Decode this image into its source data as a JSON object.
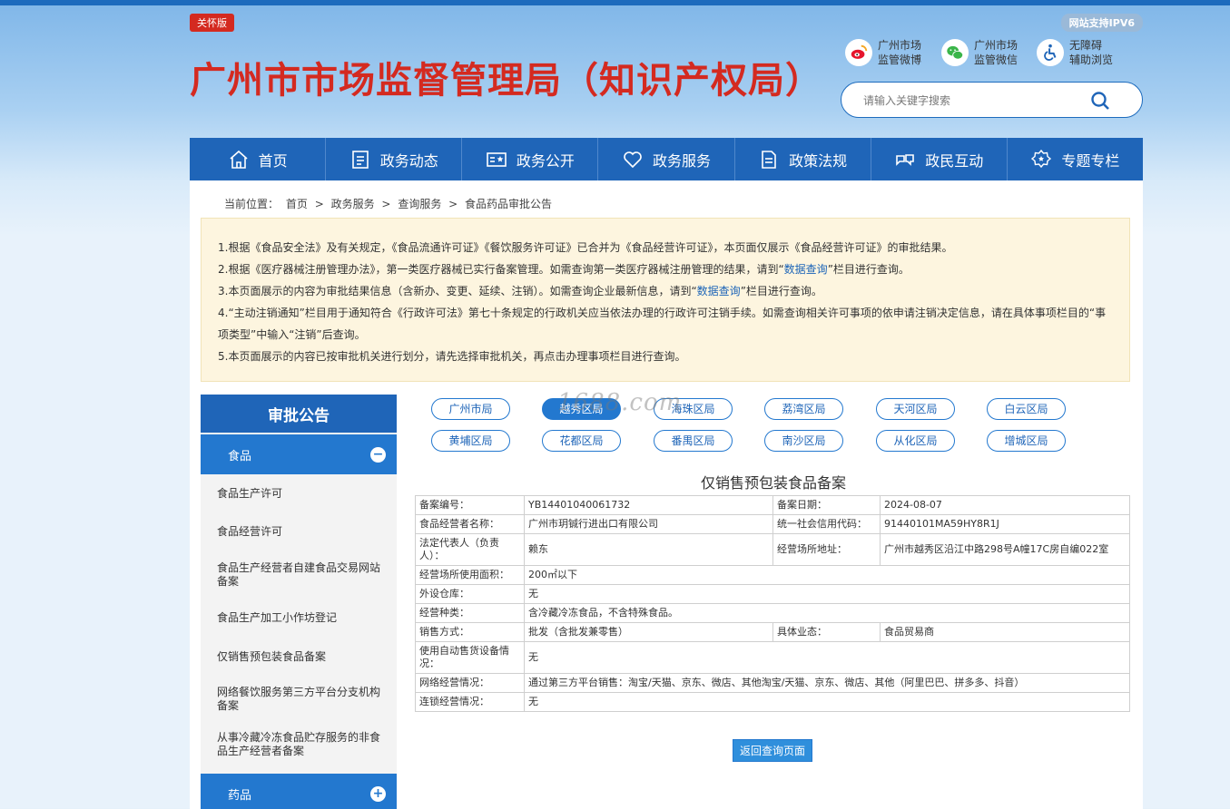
{
  "header": {
    "care_badge": "关怀版",
    "ipv6_badge": "网站支持IPV6",
    "title": "广州市市场监督管理局（知识产权局）",
    "social": [
      {
        "icon": "weibo-icon",
        "line1": "广州市场",
        "line2": "监管微博"
      },
      {
        "icon": "wechat-icon",
        "line1": "广州市场",
        "line2": "监管微信"
      },
      {
        "icon": "accessibility-icon",
        "line1": "无障碍",
        "line2": "辅助浏览"
      }
    ],
    "search_placeholder": "请输入关键字搜索"
  },
  "nav": [
    {
      "label": "首页",
      "icon": "home-icon"
    },
    {
      "label": "政务动态",
      "icon": "news-icon"
    },
    {
      "label": "政务公开",
      "icon": "open-icon"
    },
    {
      "label": "政务服务",
      "icon": "heart-icon"
    },
    {
      "label": "政策法规",
      "icon": "document-icon"
    },
    {
      "label": "政民互动",
      "icon": "interact-icon"
    },
    {
      "label": "专题专栏",
      "icon": "topic-icon"
    }
  ],
  "breadcrumb": {
    "prefix": "当前位置：",
    "items": [
      "首页",
      "政务服务",
      "查询服务",
      "食品药品审批公告"
    ],
    "sep": ">"
  },
  "notice": {
    "l1": "1.根据《食品安全法》及有关规定，《食品流通许可证》《餐饮服务许可证》已合并为《食品经营许可证》，本页面仅展示《食品经营许可证》的审批结果。",
    "l2a": "2.根据《医疗器械注册管理办法》，第一类医疗器械已实行备案管理。如需查询第一类医疗器械注册管理的结果，请到“",
    "l2link": "数据查询",
    "l2b": "”栏目进行查询。",
    "l3a": "3.本页面展示的内容为审批结果信息（含新办、变更、延续、注销）。如需查询企业最新信息，请到“",
    "l3link": "数据查询",
    "l3b": "”栏目进行查询。",
    "l4": "4.“主动注销通知”栏目用于通知符合《行政许可法》第七十条规定的行政机关应当依法办理的行政许可注销手续。如需查询相关许可事项的依申请注销决定信息，请在具体事项栏目的“事项类型”中输入“注销”后查询。",
    "l5": "5.本页面展示的内容已按审批机关进行划分，请先选择审批机关，再点击办理事项栏目进行查询。"
  },
  "sidebar": {
    "title": "审批公告",
    "cat_food": "食品",
    "cat_drug": "药品",
    "items": [
      "食品生产许可",
      "食品经营许可",
      "食品生产经营者自建食品交易网站备案",
      "食品生产加工小作坊登记",
      "仅销售预包装食品备案",
      "网络餐饮服务第三方平台分支机构备案",
      "从事冷藏冷冻食品贮存服务的非食品生产经营者备案"
    ]
  },
  "regions": [
    "广州市局",
    "越秀区局",
    "海珠区局",
    "荔湾区局",
    "天河区局",
    "白云区局",
    "黄埔区局",
    "花都区局",
    "番禺区局",
    "南沙区局",
    "从化区局",
    "增城区局"
  ],
  "watermark": "1688.com",
  "record": {
    "title": "仅销售预包装食品备案",
    "r1": {
      "k1": "备案编号：",
      "v1": "YB14401040061732",
      "k2": "备案日期：",
      "v2": "2024-08-07"
    },
    "r2": {
      "k1": "食品经营者名称：",
      "v1": "广州市玥铖行进出口有限公司",
      "k2": "统一社会信用代码：",
      "v2": "91440101MA59HY8R1J"
    },
    "r3": {
      "k1": "法定代表人（负责人）：",
      "v1": "赖东",
      "k2": "经营场所地址：",
      "v2": "广州市越秀区沿江中路298号A幢17C房自编022室"
    },
    "r4": {
      "k": "经营场所使用面积：",
      "v": "200㎡以下"
    },
    "r5": {
      "k": "外设仓库：",
      "v": "无"
    },
    "r6": {
      "k": "经营种类：",
      "v": "含冷藏冷冻食品，不含特殊食品。"
    },
    "r7": {
      "k1": "销售方式：",
      "v1": "批发（含批发兼零售）",
      "k2": "具体业态：",
      "v2": "食品贸易商"
    },
    "r8": {
      "k": "使用自动售货设备情况：",
      "v": "无"
    },
    "r9": {
      "k": "网络经营情况：",
      "v": "通过第三方平台销售：淘宝/天猫、京东、微店、其他淘宝/天猫、京东、微店、其他（阿里巴巴、拼多多、抖音）"
    },
    "r10": {
      "k": "连锁经营情况：",
      "v": "无"
    },
    "back": "返回查询页面"
  },
  "colors": {
    "brand_red": "#d42a20",
    "nav_blue": "#1f65b8",
    "link_blue": "#1a63b7"
  }
}
